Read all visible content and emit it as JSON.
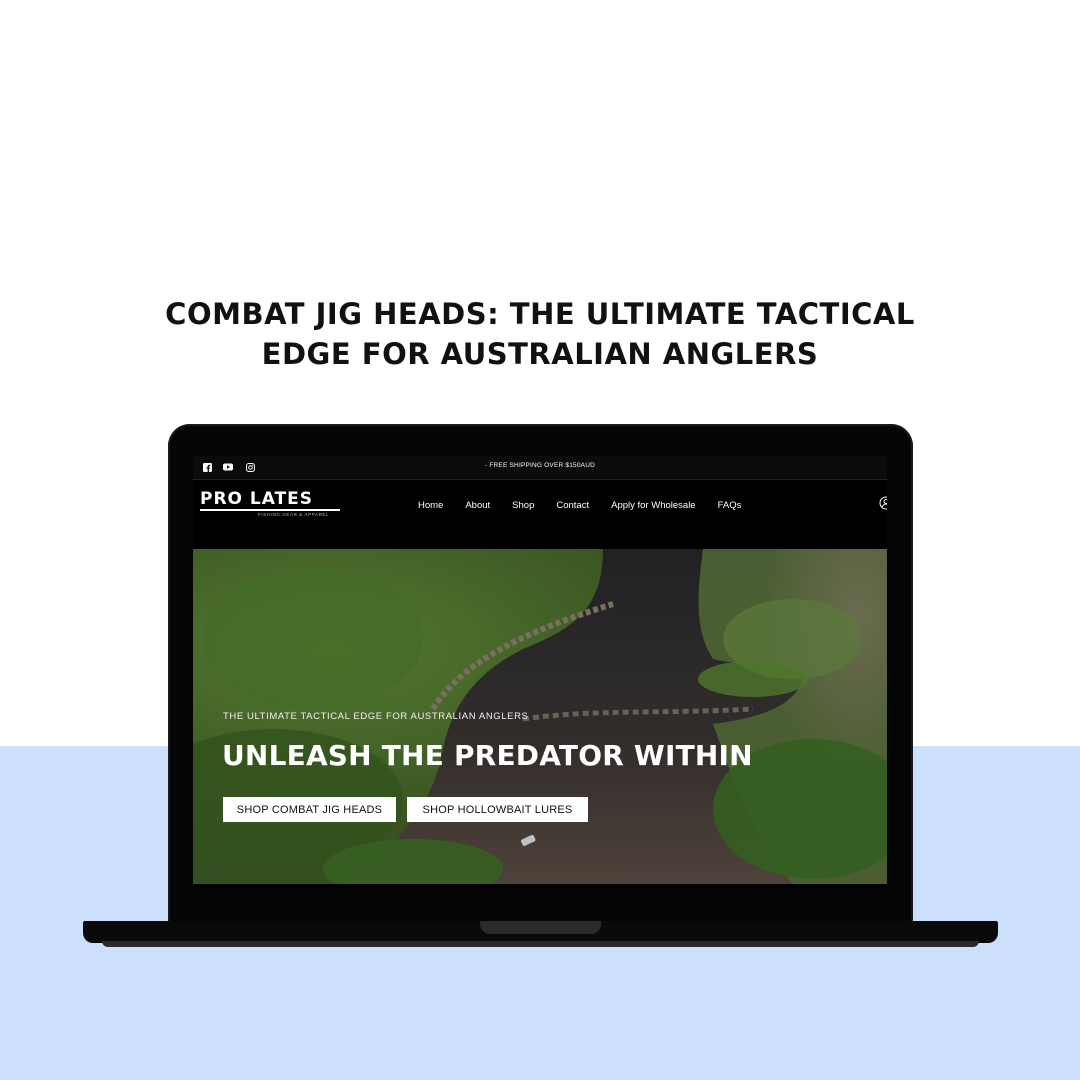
{
  "headline": {
    "line1": "COMBAT JIG HEADS: THE ULTIMATE TACTICAL",
    "line2": "EDGE FOR AUSTRALIAN ANGLERS"
  },
  "site": {
    "topbar": {
      "social_icons": [
        "facebook-icon",
        "youtube-icon",
        "instagram-icon"
      ],
      "announcement": "- FREE SHIPPING OVER $150AUD"
    },
    "logo": {
      "name": "PRO LATES",
      "tagline": "FISHING GEAR & APPAREL"
    },
    "nav": [
      "Home",
      "About",
      "Shop",
      "Contact",
      "Apply for Wholesale",
      "FAQs"
    ],
    "hero": {
      "subtitle": "THE ULTIMATE TACTICAL EDGE FOR AUSTRALIAN ANGLERS",
      "title": "UNLEASH THE PREDATOR WITHIN",
      "buttons": [
        "SHOP COMBAT JIG HEADS",
        "SHOP HOLLOWBAIT LURES"
      ]
    }
  },
  "colors": {
    "background": "#ffffff",
    "band": "#cce0fb",
    "laptop": "#050505",
    "site_bg": "#000000",
    "button_bg": "#ffffff"
  }
}
